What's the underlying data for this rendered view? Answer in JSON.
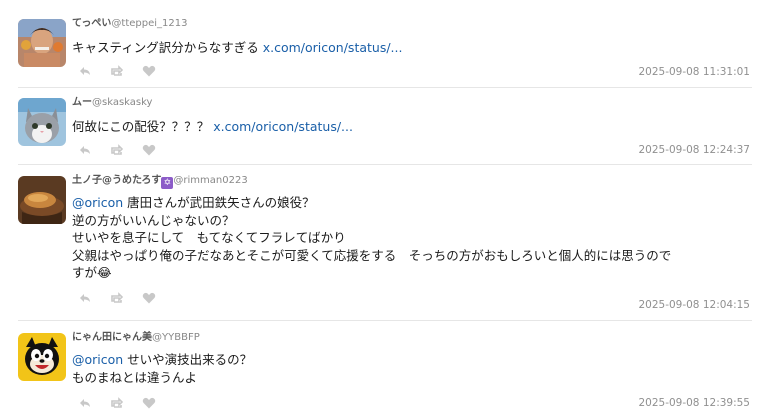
{
  "tweets": [
    {
      "name": "てっぺい",
      "handle": "@tteppei_1213",
      "avatar_icon": "person-photo-avatar",
      "lines": [
        {
          "text": "キャスティング訳分からなすぎる ",
          "link": "x.com/oricon/status/..."
        }
      ],
      "timestamp": "2025-09-08 11:31:01"
    },
    {
      "name": "ムー",
      "handle": "@skaskasky",
      "avatar_icon": "cat-photo-avatar",
      "lines": [
        {
          "text": "何故にこの配役？？？？ ",
          "link": "x.com/oricon/status/..."
        }
      ],
      "timestamp": "2025-09-08 12:24:37"
    },
    {
      "name": "土ノ子@うめたろす",
      "name_emoji": "✡",
      "handle": "@rimman0223",
      "avatar_icon": "food-photo-avatar",
      "lines": [
        {
          "mention": "@oricon",
          "text": " 唐田さんが武田鉄矢さんの娘役？"
        },
        {
          "text": "逆の方がいいんじゃないの？"
        },
        {
          "text": "せいやを息子にして　もてなくてフラレてばかり"
        },
        {
          "text": "父親はやっぱり俺の子だなあとそこが可愛くて応援をする　そっちの方がおもしろいと個人的には思うので"
        },
        {
          "text": "すが😂"
        }
      ],
      "timestamp": "2025-09-08 12:04:15"
    },
    {
      "name": "にゃん田にゃん美",
      "handle": "@YYBBFP",
      "avatar_icon": "cartoon-cat-avatar",
      "lines": [
        {
          "mention": "@oricon",
          "text": " せいや演技出来るの？"
        },
        {
          "text": "ものまねとは違うんよ"
        }
      ],
      "timestamp": "2025-09-08 12:39:55"
    }
  ],
  "action_icons": [
    "reply-icon",
    "retweet-icon",
    "like-icon"
  ],
  "colors": {
    "link": "#1a5fa8",
    "timestamp": "#909090",
    "icon": "#c8c8c8",
    "divider": "#e6e6e6"
  }
}
